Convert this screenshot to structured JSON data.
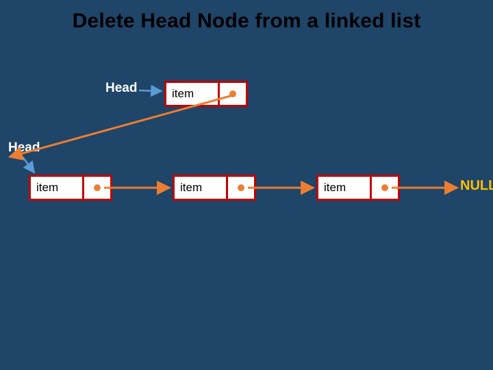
{
  "title": "Delete Head Node from a linked list",
  "labels": {
    "head_top": "Head",
    "head_left": "Head",
    "null": "NULL"
  },
  "nodes": {
    "top": {
      "item": "item"
    },
    "row": [
      {
        "item": "item"
      },
      {
        "item": "item"
      },
      {
        "item": "item"
      }
    ]
  },
  "colors": {
    "bg": "#1f4569",
    "node_border": "#c00000",
    "arrow_orange": "#ed7d31",
    "arrow_blue": "#5b9bd5",
    "null_text": "#ffc000"
  }
}
